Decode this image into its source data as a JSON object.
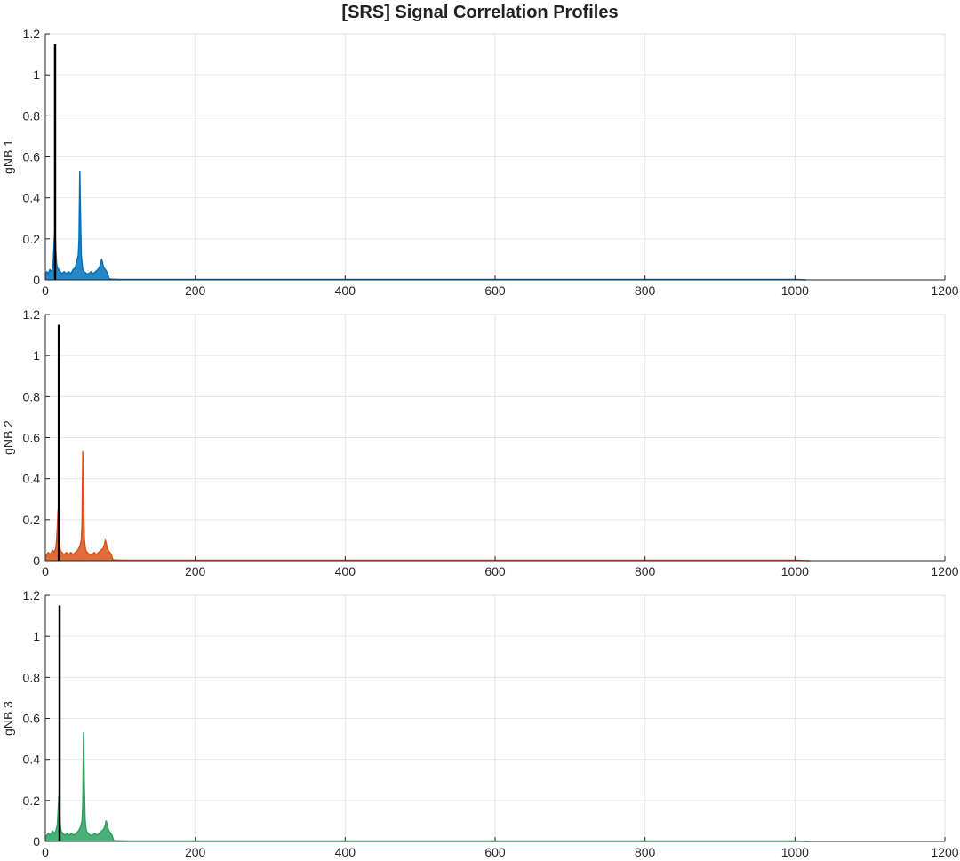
{
  "figure": {
    "title": "[SRS] Signal Correlation Profiles"
  },
  "chart_data": [
    {
      "type": "line",
      "title": "",
      "xlabel": "",
      "ylabel": "gNB 1",
      "xlim": [
        0,
        1200
      ],
      "ylim": [
        0,
        1.2
      ],
      "xticks": [
        0,
        200,
        400,
        600,
        800,
        1000,
        1200
      ],
      "yticks": [
        0,
        0.2,
        0.4,
        0.6,
        0.8,
        1,
        1.2
      ],
      "xtick_labels": [
        "0",
        "200",
        "400",
        "600",
        "800",
        "1000",
        "1200"
      ],
      "ytick_labels": [
        "0",
        "0.2",
        "0.4",
        "0.6",
        "0.8",
        "1",
        "1.2"
      ],
      "grid": true,
      "series": [
        {
          "color": "#0072BD",
          "x": [
            0,
            2,
            4,
            6,
            8,
            10,
            11,
            12,
            13,
            14,
            15,
            16,
            18,
            20,
            22,
            25,
            28,
            31,
            34,
            37,
            40,
            42,
            44,
            45,
            46,
            47,
            48,
            49,
            50,
            52,
            55,
            58,
            61,
            64,
            67,
            70,
            72,
            74,
            75,
            76,
            77,
            78,
            80,
            82,
            84,
            85,
            90,
            100,
            200,
            300,
            400,
            500,
            600,
            700,
            800,
            900,
            1000,
            1015
          ],
          "y": [
            0.02,
            0.04,
            0.03,
            0.05,
            0.04,
            0.06,
            0.12,
            0.2,
            0.25,
            0.14,
            0.08,
            0.06,
            0.05,
            0.04,
            0.03,
            0.04,
            0.03,
            0.04,
            0.03,
            0.05,
            0.06,
            0.09,
            0.12,
            0.2,
            0.53,
            0.3,
            0.12,
            0.08,
            0.05,
            0.04,
            0.03,
            0.03,
            0.04,
            0.03,
            0.04,
            0.05,
            0.06,
            0.08,
            0.1,
            0.09,
            0.07,
            0.06,
            0.05,
            0.04,
            0.02,
            0.005,
            0.003,
            0.002,
            0.002,
            0.002,
            0.002,
            0.002,
            0.002,
            0.002,
            0.002,
            0.002,
            0.002,
            0
          ]
        }
      ],
      "marker_line": {
        "x": 13,
        "y": 1.15,
        "color": "#000000"
      }
    },
    {
      "type": "line",
      "title": "",
      "xlabel": "",
      "ylabel": "gNB 2",
      "xlim": [
        0,
        1200
      ],
      "ylim": [
        0,
        1.2
      ],
      "xticks": [
        0,
        200,
        400,
        600,
        800,
        1000,
        1200
      ],
      "yticks": [
        0,
        0.2,
        0.4,
        0.6,
        0.8,
        1,
        1.2
      ],
      "xtick_labels": [
        "0",
        "200",
        "400",
        "600",
        "800",
        "1000",
        "1200"
      ],
      "ytick_labels": [
        "0",
        "0.2",
        "0.4",
        "0.6",
        "0.8",
        "1",
        "1.2"
      ],
      "grid": true,
      "series": [
        {
          "color": "#D95319",
          "x": [
            0,
            2,
            4,
            6,
            8,
            10,
            12,
            14,
            15,
            16,
            17,
            18,
            19,
            20,
            22,
            25,
            28,
            31,
            34,
            37,
            40,
            43,
            46,
            48,
            49,
            50,
            51,
            52,
            53,
            54,
            56,
            59,
            62,
            65,
            68,
            71,
            74,
            77,
            79,
            80,
            81,
            82,
            84,
            86,
            88,
            90,
            95,
            105,
            200,
            300,
            400,
            500,
            600,
            700,
            800,
            900,
            1000,
            1020
          ],
          "y": [
            0.02,
            0.03,
            0.04,
            0.03,
            0.04,
            0.05,
            0.04,
            0.06,
            0.1,
            0.16,
            0.25,
            0.15,
            0.08,
            0.05,
            0.04,
            0.03,
            0.04,
            0.03,
            0.04,
            0.03,
            0.04,
            0.05,
            0.07,
            0.1,
            0.18,
            0.53,
            0.28,
            0.11,
            0.07,
            0.05,
            0.04,
            0.03,
            0.03,
            0.04,
            0.03,
            0.04,
            0.05,
            0.06,
            0.08,
            0.1,
            0.09,
            0.07,
            0.05,
            0.04,
            0.03,
            0.005,
            0.003,
            0.002,
            0.002,
            0.002,
            0.002,
            0.002,
            0.002,
            0.002,
            0.002,
            0.002,
            0.002,
            0
          ]
        }
      ],
      "marker_line": {
        "x": 18,
        "y": 1.15,
        "color": "#000000"
      }
    },
    {
      "type": "line",
      "title": "",
      "xlabel": "",
      "ylabel": "gNB 3",
      "xlim": [
        0,
        1200
      ],
      "ylim": [
        0,
        1.2
      ],
      "xticks": [
        0,
        200,
        400,
        600,
        800,
        1000,
        1200
      ],
      "yticks": [
        0,
        0.2,
        0.4,
        0.6,
        0.8,
        1,
        1.2
      ],
      "xtick_labels": [
        "0",
        "200",
        "400",
        "600",
        "800",
        "1000",
        "1200"
      ],
      "ytick_labels": [
        "0",
        "0.2",
        "0.4",
        "0.6",
        "0.8",
        "1",
        "1.2"
      ],
      "grid": true,
      "series": [
        {
          "color": "#2CA25F",
          "x": [
            0,
            2,
            4,
            6,
            8,
            10,
            12,
            14,
            16,
            17,
            18,
            19,
            20,
            21,
            23,
            26,
            29,
            32,
            35,
            38,
            41,
            44,
            47,
            49,
            50,
            51,
            52,
            53,
            54,
            55,
            57,
            60,
            63,
            66,
            69,
            72,
            75,
            78,
            80,
            81,
            82,
            83,
            85,
            87,
            89,
            91,
            96,
            106,
            200,
            300,
            400,
            500,
            600,
            700,
            800,
            900,
            1000,
            1020
          ],
          "y": [
            0.02,
            0.03,
            0.04,
            0.03,
            0.04,
            0.05,
            0.04,
            0.05,
            0.08,
            0.14,
            0.22,
            0.14,
            0.08,
            0.05,
            0.04,
            0.03,
            0.04,
            0.03,
            0.04,
            0.03,
            0.04,
            0.05,
            0.07,
            0.1,
            0.18,
            0.53,
            0.28,
            0.11,
            0.07,
            0.05,
            0.04,
            0.03,
            0.03,
            0.04,
            0.03,
            0.04,
            0.05,
            0.06,
            0.08,
            0.1,
            0.09,
            0.07,
            0.05,
            0.04,
            0.03,
            0.005,
            0.003,
            0.002,
            0.002,
            0.002,
            0.002,
            0.002,
            0.002,
            0.002,
            0.002,
            0.002,
            0.002,
            0
          ]
        }
      ],
      "marker_line": {
        "x": 19,
        "y": 1.15,
        "color": "#000000"
      }
    }
  ]
}
